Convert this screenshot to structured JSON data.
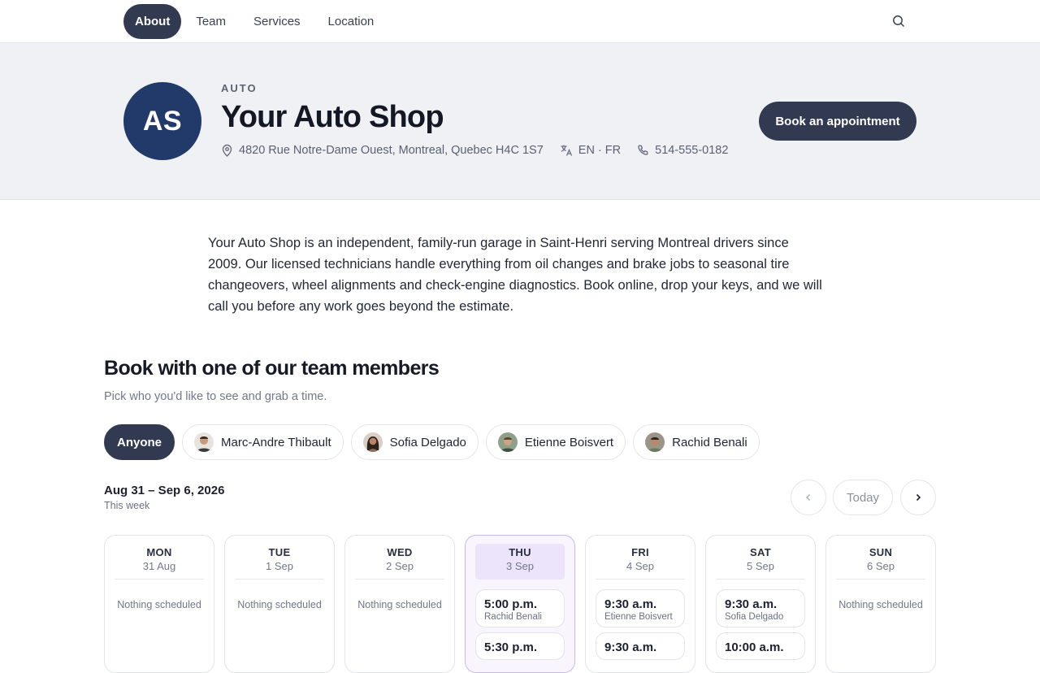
{
  "nav": {
    "tabs": [
      "About",
      "Team",
      "Services",
      "Location"
    ],
    "active": "About"
  },
  "shop": {
    "initials": "AS",
    "category": "AUTO",
    "name": "Your Auto Shop",
    "address": "4820 Rue Notre-Dame Ouest, Montreal, Quebec H4C 1S7",
    "languages": "EN · FR",
    "phone": "514-555-0182",
    "book_label": "Book an appointment"
  },
  "about": "Your Auto Shop is an independent, family-run garage in Saint-Henri serving Montreal drivers since 2009. Our licensed technicians handle everything from oil changes and brake jobs to seasonal tire changeovers, wheel alignments and check-engine diagnostics. Book online, drop your keys, and we will call you before any work goes beyond the estimate.",
  "team": {
    "title": "Book with one of our team members",
    "subtitle": "Pick who you'd like to see and grab a time.",
    "chips": [
      {
        "label": "Anyone"
      },
      {
        "label": "Marc-Andre Thibault"
      },
      {
        "label": "Sofia Delgado"
      },
      {
        "label": "Etienne Boisvert"
      },
      {
        "label": "Rachid Benali"
      }
    ]
  },
  "week": {
    "range": "Aug 31 – Sep 6, 2026",
    "label": "This week",
    "today_label": "Today"
  },
  "days": [
    {
      "dow": "MON",
      "date": "31 Aug",
      "empty": "Nothing scheduled"
    },
    {
      "dow": "TUE",
      "date": "1 Sep",
      "empty": "Nothing scheduled"
    },
    {
      "dow": "WED",
      "date": "2 Sep",
      "empty": "Nothing scheduled"
    },
    {
      "dow": "THU",
      "date": "3 Sep",
      "slots": [
        {
          "time": "5:00 p.m.",
          "who": "Rachid Benali"
        },
        {
          "time": "5:30 p.m.",
          "who": ""
        }
      ]
    },
    {
      "dow": "FRI",
      "date": "4 Sep",
      "slots": [
        {
          "time": "9:30 a.m.",
          "who": "Etienne Boisvert"
        },
        {
          "time": "9:30 a.m.",
          "who": ""
        }
      ]
    },
    {
      "dow": "SAT",
      "date": "5 Sep",
      "slots": [
        {
          "time": "9:30 a.m.",
          "who": "Sofia Delgado"
        },
        {
          "time": "10:00 a.m.",
          "who": ""
        }
      ]
    },
    {
      "dow": "SUN",
      "date": "6 Sep",
      "empty": "Nothing scheduled"
    }
  ],
  "colors": {
    "primary": "#323a52",
    "avatar": "#223a6a",
    "band": "#eff1f5",
    "today_accent": "#ece4fb"
  },
  "icons": {
    "search": "search-icon",
    "address": "map-pin-icon",
    "languages": "translate-icon",
    "phone": "phone-icon",
    "prev": "chevron-left-icon",
    "next": "chevron-right-icon"
  }
}
